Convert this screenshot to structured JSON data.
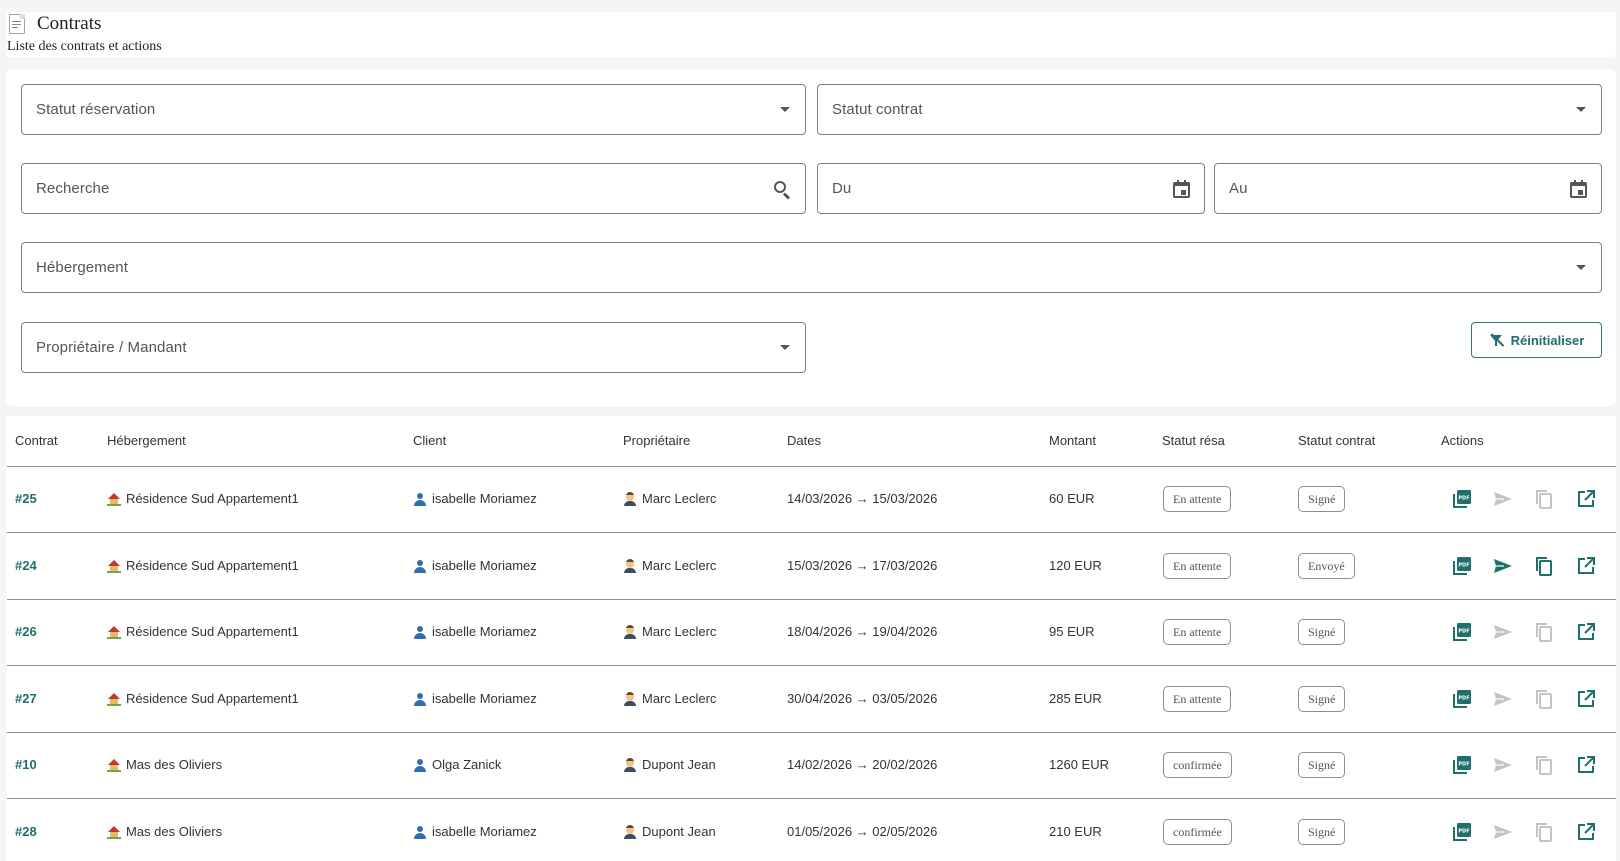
{
  "header": {
    "title": "Contrats",
    "subtitle": "Liste des contrats et actions"
  },
  "filters": {
    "statut_reservation": "Statut réservation",
    "statut_contrat": "Statut contrat",
    "recherche": "Recherche",
    "du": "Du",
    "au": "Au",
    "hebergement": "Hébergement",
    "proprietaire": "Propriétaire / Mandant",
    "reset_label": "Réinitialiser"
  },
  "table": {
    "columns": [
      "Contrat",
      "Hébergement",
      "Client",
      "Propriétaire",
      "Dates",
      "Montant",
      "Statut résa",
      "Statut contrat",
      "Actions"
    ],
    "rows": [
      {
        "id": "#25",
        "hebergement": "Résidence Sud Appartement1",
        "client": "isabelle Moriamez",
        "proprietaire": "Marc Leclerc",
        "dates": "14/03/2026 → 15/03/2026",
        "montant": "60 EUR",
        "statut_resa": "En attente",
        "statut_contrat": "Signé",
        "send_enabled": false,
        "copy_enabled": false
      },
      {
        "id": "#24",
        "hebergement": "Résidence Sud Appartement1",
        "client": "isabelle Moriamez",
        "proprietaire": "Marc Leclerc",
        "dates": "15/03/2026 → 17/03/2026",
        "montant": "120 EUR",
        "statut_resa": "En attente",
        "statut_contrat": "Envoyé",
        "send_enabled": true,
        "copy_enabled": true
      },
      {
        "id": "#26",
        "hebergement": "Résidence Sud Appartement1",
        "client": "isabelle Moriamez",
        "proprietaire": "Marc Leclerc",
        "dates": "18/04/2026 → 19/04/2026",
        "montant": "95 EUR",
        "statut_resa": "En attente",
        "statut_contrat": "Signé",
        "send_enabled": false,
        "copy_enabled": false
      },
      {
        "id": "#27",
        "hebergement": "Résidence Sud Appartement1",
        "client": "isabelle Moriamez",
        "proprietaire": "Marc Leclerc",
        "dates": "30/04/2026 → 03/05/2026",
        "montant": "285 EUR",
        "statut_resa": "En attente",
        "statut_contrat": "Signé",
        "send_enabled": false,
        "copy_enabled": false
      },
      {
        "id": "#10",
        "hebergement": "Mas des Oliviers",
        "client": "Olga Zanick",
        "proprietaire": "Dupont Jean",
        "dates": "14/02/2026 → 20/02/2026",
        "montant": "1260 EUR",
        "statut_resa": "confirmée",
        "statut_contrat": "Signé",
        "send_enabled": false,
        "copy_enabled": false
      },
      {
        "id": "#28",
        "hebergement": "Mas des Oliviers",
        "client": "isabelle Moriamez",
        "proprietaire": "Dupont Jean",
        "dates": "01/05/2026 → 02/05/2026",
        "montant": "210 EUR",
        "statut_resa": "confirmée",
        "statut_contrat": "Signé",
        "send_enabled": false,
        "copy_enabled": false
      }
    ]
  },
  "icons": {
    "page": "document-icon",
    "hebergement": "house-icon",
    "client": "user-icon",
    "proprietaire": "person-icon",
    "actions": [
      "pdf-icon",
      "send-icon",
      "copy-icon",
      "open-external-icon"
    ]
  },
  "colors": {
    "accent": "#1f6f6d",
    "disabled": "#bfc5c9",
    "border": "#7b8288",
    "background": "#f3f5f6"
  }
}
